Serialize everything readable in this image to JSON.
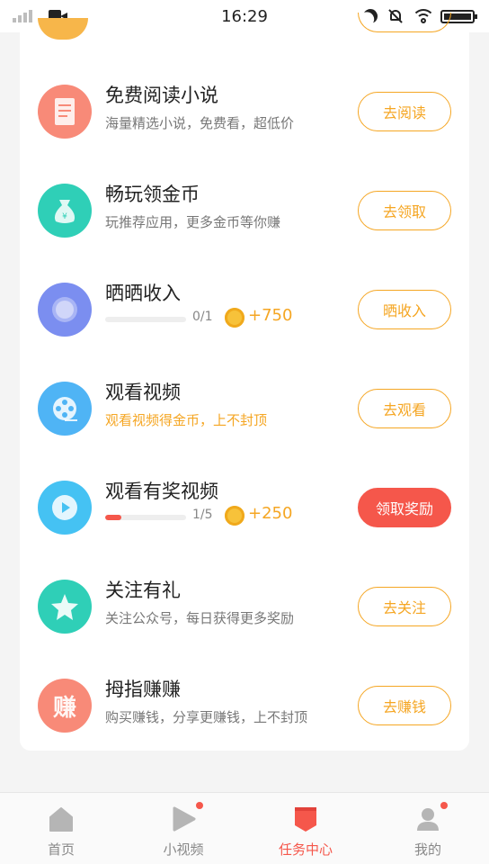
{
  "status_bar": {
    "time": "16:29"
  },
  "tasks": [
    {
      "title": "免费阅读小说",
      "subtitle": "海量精选小说，免费看，超低价",
      "button": "去阅读",
      "icon": "book-icon",
      "color": "#f88a78"
    },
    {
      "title": "畅玩领金币",
      "subtitle": "玩推荐应用，更多金币等你赚",
      "button": "去领取",
      "icon": "money-bag-icon",
      "color": "#2fcfb7"
    },
    {
      "title": "晒晒收入",
      "progress_text": "0/1",
      "progress": 0,
      "reward": "+750",
      "button": "晒收入",
      "icon": "coin-icon",
      "color": "#7b8ef0"
    },
    {
      "title": "观看视频",
      "subtitle": "观看视频得金币，上不封顶",
      "button": "去观看",
      "icon": "film-reel-icon",
      "color": "#4fb4f5"
    },
    {
      "title": "观看有奖视频",
      "progress_text": "1/5",
      "progress": 0.2,
      "reward": "+250",
      "button": "领取奖励",
      "icon": "play-icon",
      "color": "#45c2f3"
    },
    {
      "title": "关注有礼",
      "subtitle": "关注公众号，每日获得更多奖励",
      "button": "去关注",
      "icon": "star-icon",
      "color": "#2fcfb7"
    },
    {
      "title": "拇指赚赚",
      "subtitle": "购买赚钱，分享更赚钱，上不封顶",
      "button": "去赚钱",
      "icon": "earn-logo-icon",
      "color": "#f88a78",
      "logo_text": "赚"
    }
  ],
  "nav": [
    {
      "label": "首页",
      "icon": "home-icon"
    },
    {
      "label": "小视频",
      "icon": "video-play-icon"
    },
    {
      "label": "任务中心",
      "icon": "task-flag-icon"
    },
    {
      "label": "我的",
      "icon": "profile-icon"
    }
  ]
}
